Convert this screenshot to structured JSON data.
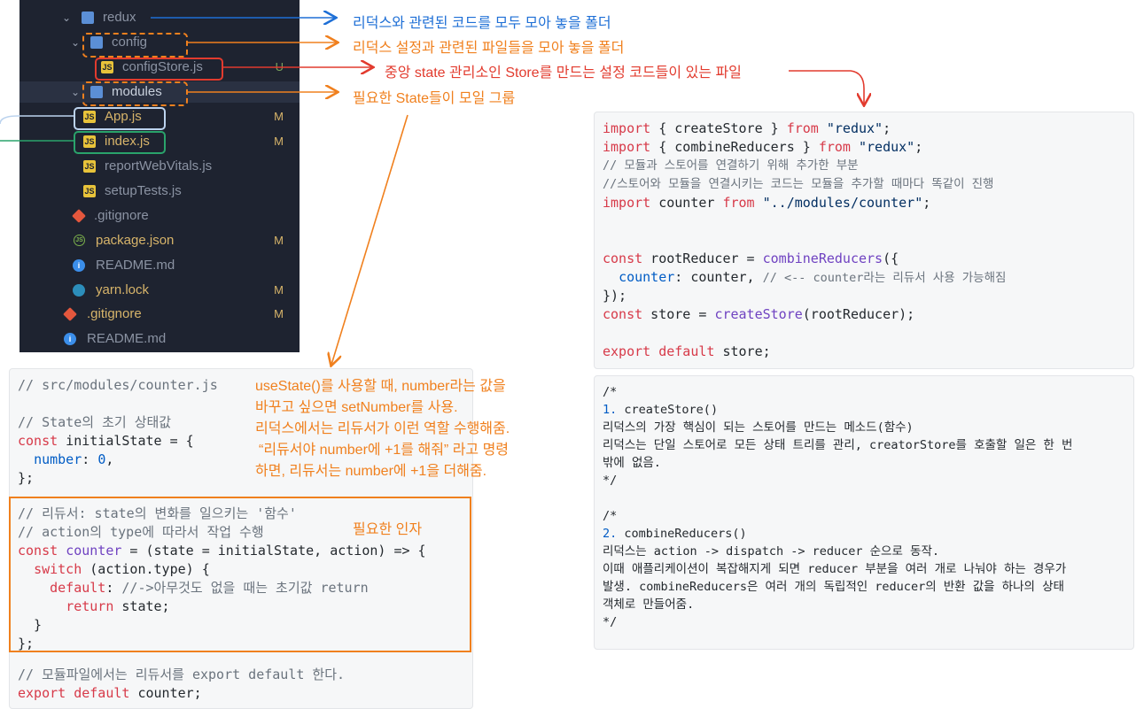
{
  "tree": [
    {
      "label": "redux",
      "icon": "folder",
      "status": ""
    },
    {
      "label": "config",
      "icon": "folder",
      "status": ""
    },
    {
      "label": "configStore.js",
      "icon": "js",
      "status": "U"
    },
    {
      "label": "modules",
      "icon": "folder",
      "status": ""
    },
    {
      "label": "App.js",
      "icon": "js",
      "status": "M"
    },
    {
      "label": "index.js",
      "icon": "js",
      "status": "M"
    },
    {
      "label": "reportWebVitals.js",
      "icon": "js",
      "status": ""
    },
    {
      "label": "setupTests.js",
      "icon": "js",
      "status": ""
    },
    {
      "label": ".gitignore",
      "icon": "git",
      "status": ""
    },
    {
      "label": "package.json",
      "icon": "json",
      "status": "M"
    },
    {
      "label": "README.md",
      "icon": "info",
      "status": ""
    },
    {
      "label": "yarn.lock",
      "icon": "yarn",
      "status": "M"
    },
    {
      "label": ".gitignore",
      "icon": "git",
      "status": "M"
    },
    {
      "label": "README.md",
      "icon": "info",
      "status": ""
    }
  ],
  "annotations": {
    "redux": "리덕스와 관련된 코드를 모두 모아 놓을 폴더",
    "config": "리덕스 설정과 관련된 파일들을 모아 놓을 폴더",
    "store": "중앙 state 관리소인 Store를 만드는 설정 코드들이 있는 파일",
    "modules": "필요한 State들이 모일 그룹",
    "param": "필요한 인자",
    "explain": [
      "useState()를 사용할 때, number라는 값을",
      "바꾸고 싶으면 setNumber를 사용.",
      "리덕스에서는 리듀서가 이런 역할 수행해줌.",
      "“리듀서야 number에 +1를 해줘” 라고 명령",
      "하면, 리듀서는 number에 +1을 더해줌."
    ]
  },
  "code_counter": {
    "path": "// src/modules/counter.js",
    "init_comment": "// State의 초기 상태값",
    "reducer_comment1": "// 리듀서: state의 변화를 일으키는 '함수'",
    "reducer_comment2": "// action의 type에 따라서 작업 수행",
    "default_comment": "//->아무것도 없을 때는 초기값 return",
    "export_comment": "// 모듈파일에서는 리듀서를 export default 한다."
  },
  "code_store": {
    "comment1": "// 모듈과 스토어를 연결하기 위해 추가한 부분",
    "comment2": "//스토어와 모듈을 연결시키는 코드는 모듈을 추가할 때마다 똑같이 진행",
    "counter_comment": "// <-- counter라는 리듀서 사용 가능해짐"
  },
  "code_doc": [
    "/*",
    "1. createStore()",
    "리덕스의 가장 핵심이 되는 스토어를 만드는 메소드(함수)",
    "리덕스는 단일 스토어로 모든 상태 트리를 관리, creatorStore를 호출할 일은 한 번",
    "밖에 없음.",
    "*/",
    "",
    "/*",
    "2. combineReducers()",
    "리덕스는 action -> dispatch -> reducer 순으로 동작.",
    "이때 애플리케이션이 복잡해지게 되면 reducer 부분을 여러 개로 나눠야 하는 경우가",
    "발생. combineReducers은 여러 개의 독립적인 reducer의 반환 값을 하나의 상태",
    "객체로 만들어줌.",
    "*/"
  ],
  "colors": {
    "orange": "#f0801e",
    "blue": "#1e6fd6",
    "red": "#e23b2e",
    "tree_bg": "#1e2330"
  }
}
